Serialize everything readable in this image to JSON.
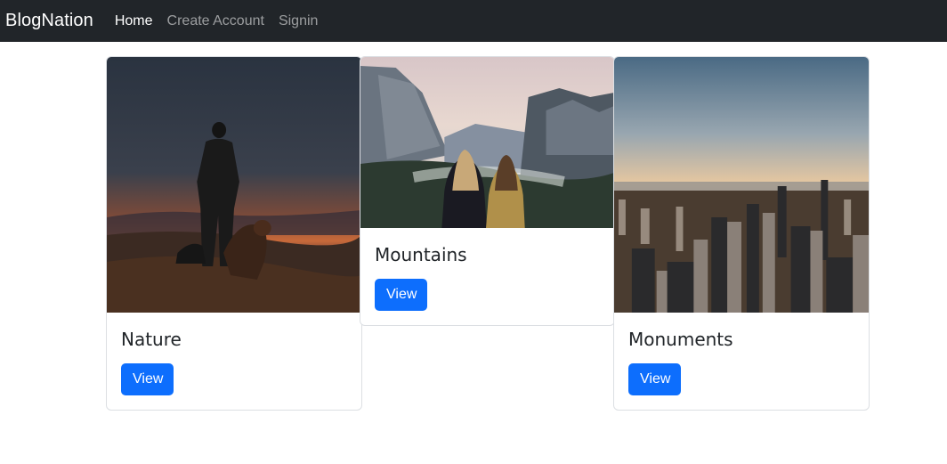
{
  "navbar": {
    "brand": "BlogNation",
    "links": [
      "Home",
      "Create Account",
      "Signin"
    ]
  },
  "cards": [
    {
      "title": "Nature",
      "button": "View",
      "image": "person-and-dog-at-sunset"
    },
    {
      "title": "Mountains",
      "button": "View",
      "image": "two-women-facing-mountain-valley"
    },
    {
      "title": "Monuments",
      "button": "View",
      "image": "city-skyline-at-sunset"
    }
  ],
  "colors": {
    "navbar_bg": "#212529",
    "button_bg": "#0d6efd"
  }
}
